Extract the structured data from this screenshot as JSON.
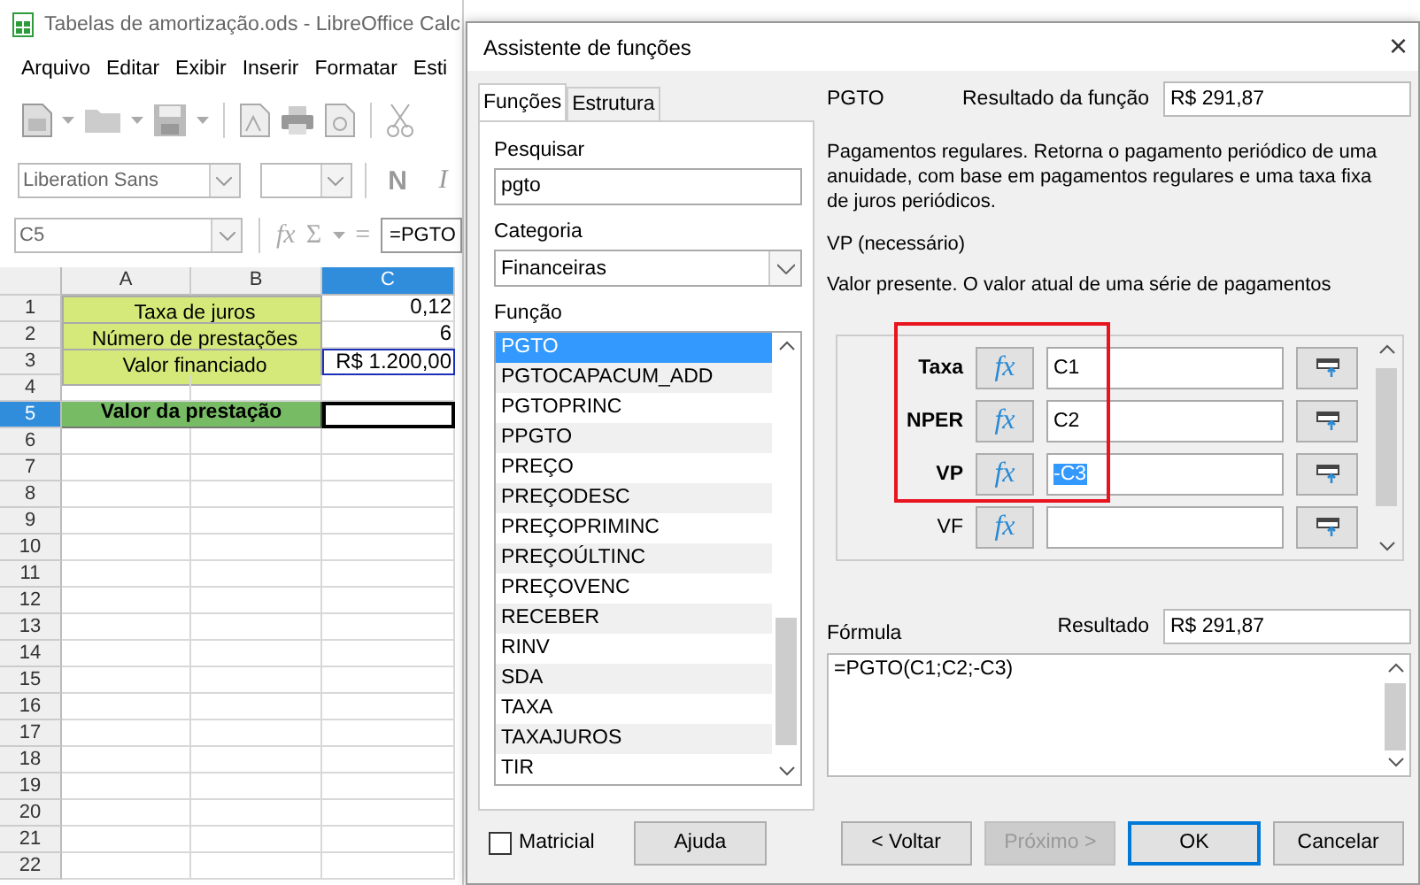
{
  "calc": {
    "title": "Tabelas de amortização.ods - LibreOffice Calc",
    "menu": [
      "Arquivo",
      "Editar",
      "Exibir",
      "Inserir",
      "Formatar",
      "Esti"
    ],
    "font_name": "Liberation Sans",
    "bold_button": "N",
    "italic_button": "I",
    "name_box": "C5",
    "function_symbol": "fx",
    "sum_symbol": "Σ",
    "equals_symbol": "=",
    "formula": "=PGTO",
    "columns": [
      {
        "label": "A",
        "selected": false
      },
      {
        "label": "B",
        "selected": false
      },
      {
        "label": "C",
        "selected": true
      }
    ],
    "rows": [
      {
        "number": "1",
        "selected": false,
        "kind": "input",
        "label": "Taxa de juros",
        "value": "0,12",
        "referenced": false
      },
      {
        "number": "2",
        "selected": false,
        "kind": "input",
        "label": "Número de prestações",
        "value": "6",
        "referenced": false
      },
      {
        "number": "3",
        "selected": false,
        "kind": "input",
        "label": "Valor financiado",
        "value": "R$ 1.200,00",
        "referenced": true
      },
      {
        "number": "4",
        "selected": false,
        "kind": "empty"
      },
      {
        "number": "5",
        "selected": true,
        "kind": "result",
        "label": "Valor da prestação"
      },
      {
        "number": "6",
        "selected": false,
        "kind": "empty"
      },
      {
        "number": "7",
        "selected": false,
        "kind": "empty"
      },
      {
        "number": "8",
        "selected": false,
        "kind": "empty"
      },
      {
        "number": "9",
        "selected": false,
        "kind": "empty"
      },
      {
        "number": "10",
        "selected": false,
        "kind": "empty"
      },
      {
        "number": "11",
        "selected": false,
        "kind": "empty"
      },
      {
        "number": "12",
        "selected": false,
        "kind": "empty"
      },
      {
        "number": "13",
        "selected": false,
        "kind": "empty"
      },
      {
        "number": "14",
        "selected": false,
        "kind": "empty"
      },
      {
        "number": "15",
        "selected": false,
        "kind": "empty"
      },
      {
        "number": "16",
        "selected": false,
        "kind": "empty"
      },
      {
        "number": "17",
        "selected": false,
        "kind": "empty"
      },
      {
        "number": "18",
        "selected": false,
        "kind": "empty"
      },
      {
        "number": "19",
        "selected": false,
        "kind": "empty"
      },
      {
        "number": "20",
        "selected": false,
        "kind": "empty"
      },
      {
        "number": "21",
        "selected": false,
        "kind": "empty"
      },
      {
        "number": "22",
        "selected": false,
        "kind": "empty"
      }
    ]
  },
  "dialog": {
    "title": "Assistente de funções",
    "close": "×",
    "tabs": [
      {
        "label": "Funções",
        "selected": true
      },
      {
        "label": "Estrutura",
        "selected": false
      }
    ],
    "search": {
      "label": "Pesquisar",
      "value": "pgto"
    },
    "category": {
      "label": "Categoria",
      "value": "Financeiras"
    },
    "function_list": {
      "label": "Função",
      "items": [
        {
          "name": "PGTO",
          "selected": true
        },
        {
          "name": "PGTOCAPACUM_ADD",
          "selected": false
        },
        {
          "name": "PGTOPRINC",
          "selected": false
        },
        {
          "name": "PPGTO",
          "selected": false
        },
        {
          "name": "PREÇO",
          "selected": false
        },
        {
          "name": "PREÇODESC",
          "selected": false
        },
        {
          "name": "PREÇOPRIMINC",
          "selected": false
        },
        {
          "name": "PREÇOÚLTINC",
          "selected": false
        },
        {
          "name": "PREÇOVENC",
          "selected": false
        },
        {
          "name": "RECEBER",
          "selected": false
        },
        {
          "name": "RINV",
          "selected": false
        },
        {
          "name": "SDA",
          "selected": false
        },
        {
          "name": "TAXA",
          "selected": false
        },
        {
          "name": "TAXAJUROS",
          "selected": false
        },
        {
          "name": "TIR",
          "selected": false
        }
      ]
    },
    "function_name": "PGTO",
    "function_result": {
      "label": "Resultado da função",
      "value": "R$ 291,87"
    },
    "description": "Pagamentos regulares. Retorna o pagamento periódico de uma anuidade, com base em pagamentos regulares e uma taxa fixa de juros periódicos.",
    "argument_name": "VP (necessário)",
    "argument_description": "Valor presente. O valor atual de uma série de pagamentos",
    "arguments": [
      {
        "name": "Taxa",
        "required": true,
        "button": "fx",
        "value": "C1",
        "text_selected": false
      },
      {
        "name": "NPER",
        "required": true,
        "button": "fx",
        "value": "C2",
        "text_selected": false
      },
      {
        "name": "VP",
        "required": true,
        "button": "fx",
        "value": "-C3",
        "text_selected": true
      },
      {
        "name": "VF",
        "required": false,
        "button": "fx"
      }
    ],
    "formula": {
      "label": "Fórmula",
      "value": "=PGTO(C1;C2;-C3)"
    },
    "result": {
      "label": "Resultado",
      "value": "R$ 291,87"
    },
    "matricial": {
      "label": "Matricial",
      "checked": false
    },
    "buttons": [
      {
        "label": "Ajuda",
        "disabled": false,
        "default": false
      },
      {
        "label": "< Voltar",
        "disabled": false,
        "default": false
      },
      {
        "label": "Próximo >",
        "disabled": true,
        "default": false
      },
      {
        "label": "OK",
        "disabled": false,
        "default": true
      },
      {
        "label": "Cancelar",
        "disabled": false,
        "default": false
      }
    ]
  }
}
